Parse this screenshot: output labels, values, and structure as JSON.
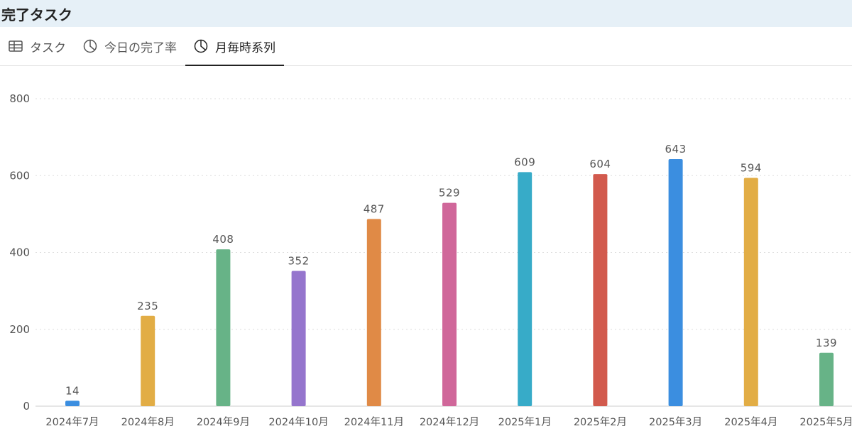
{
  "header": {
    "title": "完了タスク"
  },
  "tabs": [
    {
      "label": "タスク",
      "icon": "table-icon",
      "active": false
    },
    {
      "label": "今日の完了率",
      "icon": "pie-chart-icon",
      "active": false
    },
    {
      "label": "月毎時系列",
      "icon": "pie-chart-icon",
      "active": true
    }
  ],
  "chart_data": {
    "type": "bar",
    "categories": [
      "2024年7月",
      "2024年8月",
      "2024年9月",
      "2024年10月",
      "2024年11月",
      "2024年12月",
      "2025年1月",
      "2025年2月",
      "2025年3月",
      "2025年4月",
      "2025年5月"
    ],
    "values": [
      14,
      235,
      408,
      352,
      487,
      529,
      609,
      604,
      643,
      594,
      139
    ],
    "colors": [
      "#3b8ee0",
      "#e2ad45",
      "#67b387",
      "#9575cd",
      "#e08a46",
      "#d0679a",
      "#37abc8",
      "#d25a4d",
      "#3b8ee0",
      "#e2ad45",
      "#67b387"
    ],
    "ylim": [
      0,
      800
    ],
    "yticks": [
      0,
      200,
      400,
      600,
      800
    ],
    "grid": true,
    "data_labels": true
  }
}
